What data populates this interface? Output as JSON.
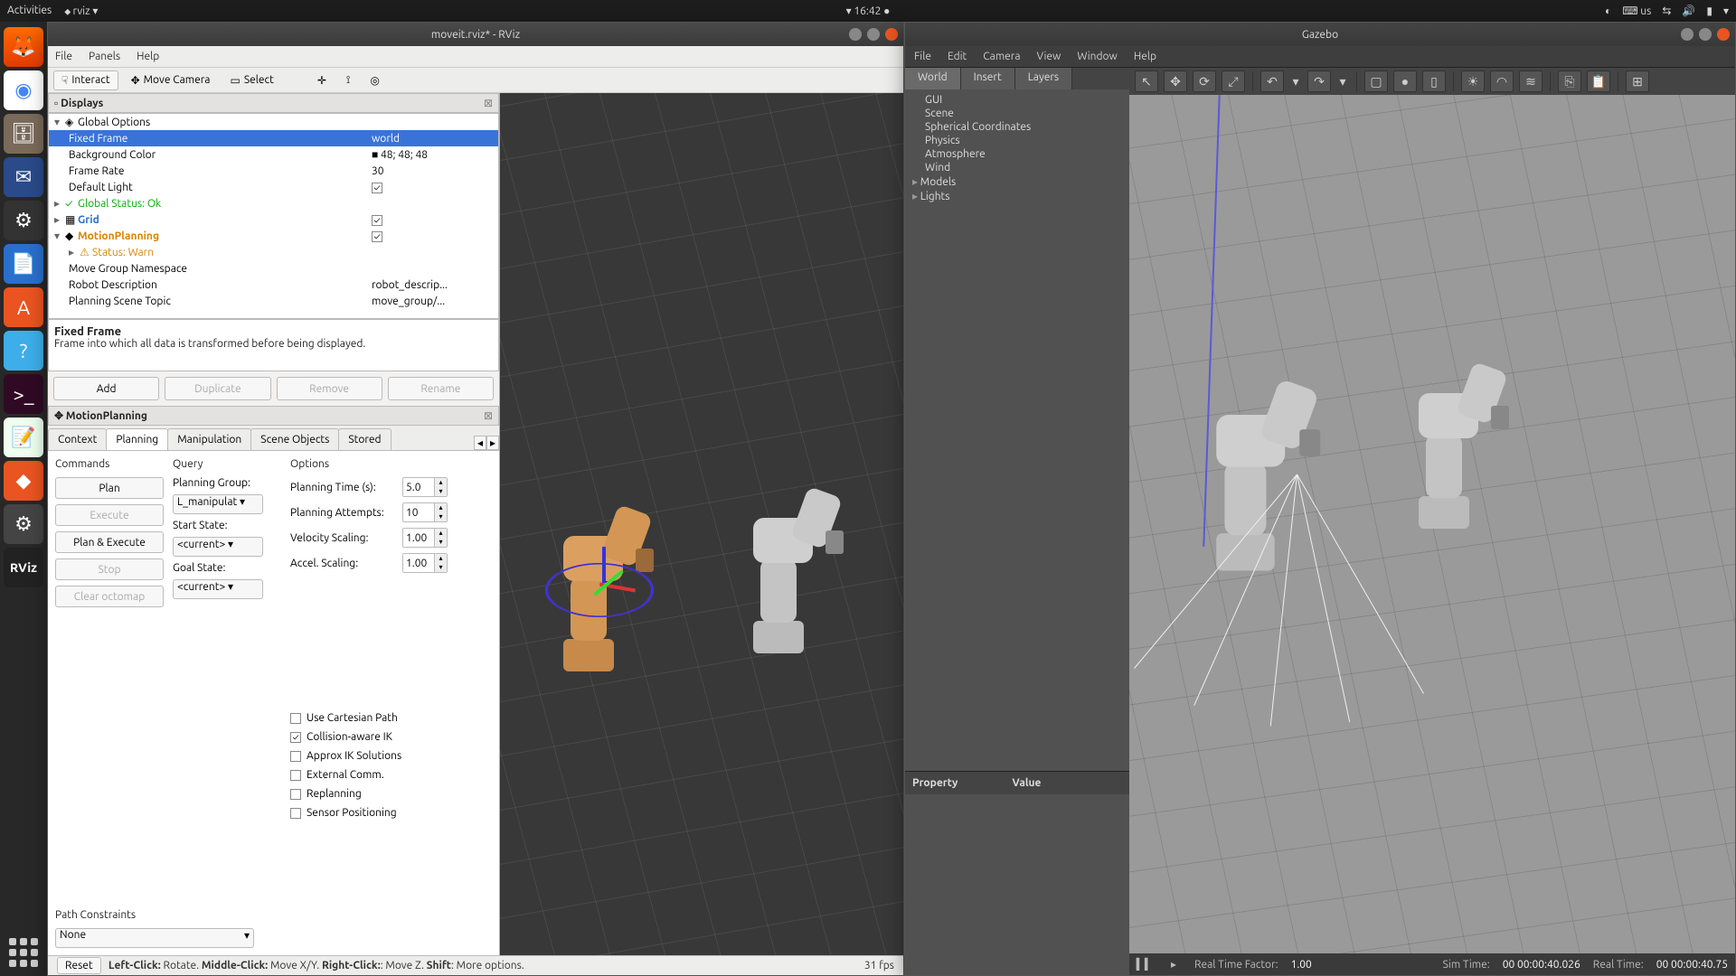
{
  "topbar": {
    "activities": "Activities",
    "app": "rviz",
    "time": "16:42",
    "keyboard": "us"
  },
  "dock": [
    "Firefox",
    "Chrome",
    "Files",
    "Thunderbird",
    "Gears",
    "LibreOffice",
    "Software",
    "Help",
    "Terminal",
    "TextEditor",
    "Orange",
    "Settings",
    "RViz"
  ],
  "rviz": {
    "title": "moveit.rviz* - RViz",
    "menus": [
      "File",
      "Panels",
      "Help"
    ],
    "toolbar": {
      "interact": "Interact",
      "move": "Move Camera",
      "select": "Select"
    },
    "displays": {
      "title": "Displays",
      "global_options": "Global Options",
      "fixed_frame": {
        "label": "Fixed Frame",
        "value": "world"
      },
      "bg": {
        "label": "Background Color",
        "value": "48; 48; 48"
      },
      "fps": {
        "label": "Frame Rate",
        "value": "30"
      },
      "light": {
        "label": "Default Light",
        "checked": true
      },
      "global_status": "Global Status: Ok",
      "grid": "Grid",
      "mp": "MotionPlanning",
      "status_warn": "Status: Warn",
      "mgns": "Move Group Namespace",
      "rdesc": {
        "label": "Robot Description",
        "value": "robot_descrip..."
      },
      "pst": {
        "label": "Planning Scene Topic",
        "value": "move_group/..."
      }
    },
    "desc": {
      "title": "Fixed Frame",
      "text": "Frame into which all data is transformed before being displayed."
    },
    "buttons": {
      "add": "Add",
      "dup": "Duplicate",
      "rem": "Remove",
      "ren": "Rename"
    },
    "mp_panel": {
      "title": "MotionPlanning",
      "tabs": [
        "Context",
        "Planning",
        "Manipulation",
        "Scene Objects",
        "Stored"
      ],
      "active_tab": 1,
      "commands": {
        "title": "Commands",
        "plan": "Plan",
        "execute": "Execute",
        "pe": "Plan & Execute",
        "stop": "Stop",
        "clear": "Clear octomap"
      },
      "query": {
        "title": "Query",
        "pg": "Planning Group:",
        "pg_val": "L_manipulat",
        "ss": "Start State:",
        "ss_val": "<current>",
        "gs": "Goal State:",
        "gs_val": "<current>"
      },
      "options": {
        "title": "Options",
        "pt": "Planning Time (s):",
        "pt_val": "5.0",
        "pa": "Planning Attempts:",
        "pa_val": "10",
        "vs": "Velocity Scaling:",
        "vs_val": "1.00",
        "as": "Accel. Scaling:",
        "as_val": "1.00"
      },
      "checks": {
        "cart": "Use Cartesian Path",
        "cik": "Collision-aware IK",
        "aik": "Approx IK Solutions",
        "ext": "External Comm.",
        "rep": "Replanning",
        "sen": "Sensor Positioning"
      },
      "path": {
        "label": "Path Constraints",
        "value": "None"
      }
    },
    "status": {
      "reset": "Reset",
      "hint_left": "Left-Click:",
      "hint_left_t": " Rotate. ",
      "hint_mid": "Middle-Click:",
      "hint_mid_t": " Move X/Y. ",
      "hint_right": "Right-Click:",
      "hint_right_t": ": Move Z. ",
      "hint_shift": "Shift",
      "hint_shift_t": ": More options.",
      "fps": "31 fps"
    }
  },
  "gazebo": {
    "title": "Gazebo",
    "menus": [
      "File",
      "Edit",
      "Camera",
      "View",
      "Window",
      "Help"
    ],
    "tabs": [
      "World",
      "Insert",
      "Layers"
    ],
    "tree": [
      "GUI",
      "Scene",
      "Spherical Coordinates",
      "Physics",
      "Atmosphere",
      "Wind",
      "Models",
      "Lights"
    ],
    "prop": {
      "p": "Property",
      "v": "Value"
    },
    "status": {
      "rtf_l": "Real Time Factor:",
      "rtf": "1.00",
      "sim_l": "Sim Time:",
      "sim": "00 00:00:40.026",
      "rt_l": "Real Time:",
      "rt": "00 00:00:40.75"
    }
  }
}
